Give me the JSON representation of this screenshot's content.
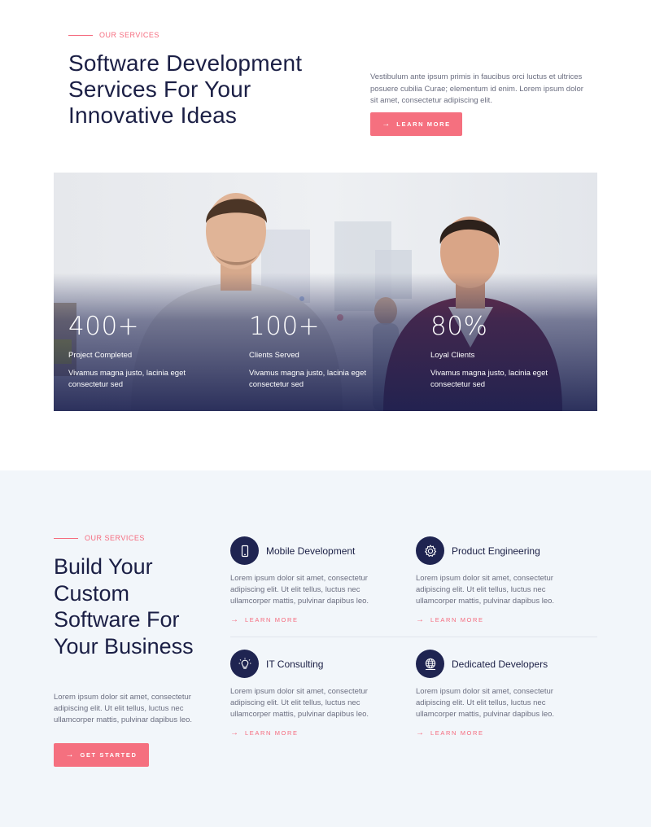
{
  "top": {
    "eyebrow": "OUR SERVICES",
    "title": "Software Development Services For Your Innovative Ideas",
    "description": "Vestibulum ante ipsum primis in faucibus orci luctus et ultrices posuere cubilia Curae;  elementum id enim. Lorem ipsum dolor sit amet, consectetur adipiscing elit.",
    "button_label": "LEARN MORE",
    "button_icon": "arrow-right-icon"
  },
  "stats": [
    {
      "value": "400+",
      "label": "Project Completed",
      "description": "Vivamus magna justo, lacinia eget consectetur sed"
    },
    {
      "value": "100+",
      "label": "Clients Served",
      "description": "Vivamus magna justo, lacinia eget consectetur sed"
    },
    {
      "value": "80%",
      "label": "Loyal Clients",
      "description": "Vivamus magna justo, lacinia eget consectetur sed"
    }
  ],
  "services": {
    "eyebrow": "OUR SERVICES",
    "title": "Build Your Custom Software For Your Business",
    "description": "Lorem ipsum dolor sit amet, consectetur adipiscing elit. Ut elit tellus, luctus nec ullamcorper mattis, pulvinar dapibus leo.",
    "button_label": "GET STARTED",
    "cards": [
      {
        "title": "Mobile Development",
        "icon": "mobile-phone-icon",
        "description": "Lorem ipsum dolor sit amet, consectetur adipiscing elit. Ut elit tellus, luctus nec ullamcorper mattis, pulvinar dapibus leo.",
        "link": "LEARN MORE"
      },
      {
        "title": "Product Engineering",
        "icon": "gear-icon",
        "description": "Lorem ipsum dolor sit amet, consectetur adipiscing elit. Ut elit tellus, luctus nec ullamcorper mattis, pulvinar dapibus leo.",
        "link": "LEARN MORE"
      },
      {
        "title": "IT Consulting",
        "icon": "lightbulb-icon",
        "description": "Lorem ipsum dolor sit amet, consectetur adipiscing elit. Ut elit tellus, luctus nec ullamcorper mattis, pulvinar dapibus leo.",
        "link": "LEARN MORE"
      },
      {
        "title": "Dedicated Developers",
        "icon": "globe-icon",
        "description": "Lorem ipsum dolor sit amet, consectetur adipiscing elit. Ut elit tellus, luctus nec ullamcorper mattis, pulvinar dapibus leo.",
        "link": "LEARN MORE"
      }
    ]
  },
  "colors": {
    "accent": "#f5707f",
    "navy": "#1b1f45",
    "section_bg": "#f2f6fa"
  }
}
